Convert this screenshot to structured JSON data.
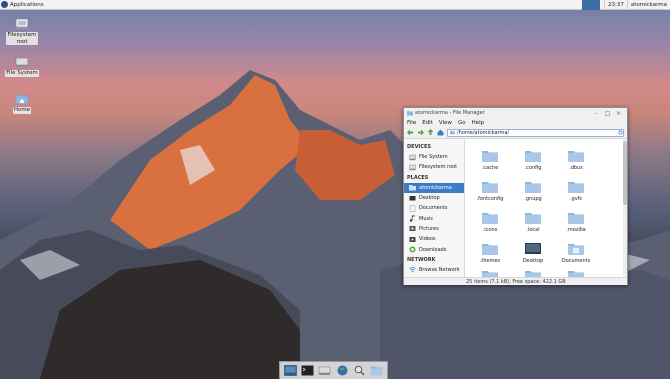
{
  "top_panel": {
    "applications_label": "Applications",
    "clock": "23:37",
    "username": "atomickarma"
  },
  "desktop": {
    "icons": [
      {
        "label_line1": "Filesystem",
        "label_line2": "root",
        "icon": "drive-icon"
      },
      {
        "label_line1": "File System",
        "icon": "drive-icon"
      },
      {
        "label_line1": "Home",
        "icon": "home-folder-icon"
      }
    ]
  },
  "file_manager": {
    "title": "atomickarma - File Manager",
    "menu": [
      "File",
      "Edit",
      "View",
      "Go",
      "Help"
    ],
    "path": "/home/atomickarma/",
    "sidebar": {
      "devices_heading": "DEVICES",
      "devices": [
        {
          "label": "File System",
          "icon": "drive-icon"
        },
        {
          "label": "Filesystem root",
          "icon": "drive-icon"
        }
      ],
      "places_heading": "PLACES",
      "places": [
        {
          "label": "atomickarma",
          "icon": "home-folder-icon",
          "active": true
        },
        {
          "label": "Desktop",
          "icon": "desktop-icon"
        },
        {
          "label": "Documents",
          "icon": "documents-icon"
        },
        {
          "label": "Music",
          "icon": "music-icon"
        },
        {
          "label": "Pictures",
          "icon": "pictures-icon"
        },
        {
          "label": "Videos",
          "icon": "videos-icon"
        },
        {
          "label": "Downloads",
          "icon": "downloads-icon"
        }
      ],
      "network_heading": "NETWORK",
      "network": [
        {
          "label": "Browse Network",
          "icon": "wifi-icon"
        }
      ]
    },
    "files": [
      {
        "name": ".cache"
      },
      {
        "name": ".config"
      },
      {
        "name": ".dbus"
      },
      {
        "name": ".fontconfig"
      },
      {
        "name": ".gnupg"
      },
      {
        "name": ".gvfs"
      },
      {
        "name": ".icons"
      },
      {
        "name": ".local"
      },
      {
        "name": ".mozilla"
      },
      {
        "name": ".themes"
      },
      {
        "name": "Desktop"
      },
      {
        "name": "Documents"
      },
      {
        "name": ""
      },
      {
        "name": ""
      },
      {
        "name": ""
      }
    ],
    "status": "25 items (7.1 kB), Free space: 422.1 GB"
  },
  "dock": {
    "items": [
      "show-desktop-icon",
      "terminal-icon",
      "drive-icon",
      "web-browser-icon",
      "search-icon",
      "folder-icon"
    ]
  },
  "colors": {
    "accent": "#3d7cc9",
    "folder": "#8fb6dd"
  }
}
